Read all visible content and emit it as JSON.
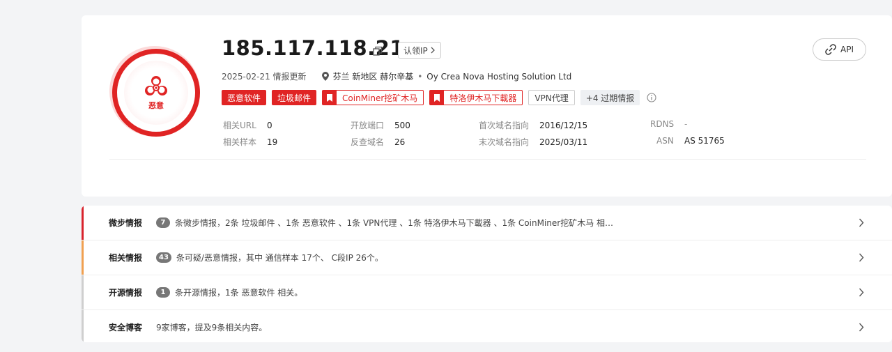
{
  "header": {
    "ip": "185.117.118.21",
    "claim_label": "认领IP",
    "api_label": "API",
    "badge_label": "恶意",
    "updated": "2025-02-21 情报更新",
    "location": "芬兰 新地区 赫尔辛基",
    "isp": "Oy Crea Nova Hosting Solution Ltd",
    "tags": [
      {
        "label": "恶意软件",
        "style": "solid"
      },
      {
        "label": "垃圾邮件",
        "style": "solid"
      },
      {
        "label": "CoinMiner挖矿木马",
        "style": "outline-red"
      },
      {
        "label": "特洛伊木马下載器",
        "style": "outline-red"
      },
      {
        "label": "VPN代理",
        "style": "gray"
      },
      {
        "label": "+4 过期情报",
        "style": "more"
      }
    ]
  },
  "stats": {
    "related_url_label": "相关URL",
    "related_url": "0",
    "related_samples_label": "相关样本",
    "related_samples": "19",
    "open_ports_label": "开放端口",
    "open_ports": "500",
    "reverse_domains_label": "反查域名",
    "reverse_domains": "26",
    "first_domain_label": "首次域名指向",
    "first_domain": "2016/12/15",
    "last_domain_label": "末次域名指向",
    "last_domain": "2025/03/11",
    "rdns_label": "RDNS",
    "rdns": "-",
    "asn_label": "ASN",
    "asn": "AS 51765"
  },
  "intel": [
    {
      "title": "微步情报",
      "count": "7",
      "text": "条微步情报，2条 垃圾邮件 、1条 恶意软件 、1条 VPN代理 、1条 特洛伊木马下載器 、1条 CoinMiner挖矿木马 相…",
      "color": "#d9232d"
    },
    {
      "title": "相关情报",
      "count": "43",
      "text": "条可疑/恶意情报，其中 通信样本 17个、 C段IP 26个。",
      "color": "#f0a050"
    },
    {
      "title": "开源情报",
      "count": "1",
      "text": "条开源情报，1条 恶意软件 相关。",
      "color": "#cfcfcf"
    },
    {
      "title": "安全博客",
      "count": "",
      "text": "9家博客，提及9条相关内容。",
      "color": "#cfcfcf"
    }
  ],
  "colors": {
    "accent_red": "#e02424",
    "bg": "#f3f4f6"
  }
}
